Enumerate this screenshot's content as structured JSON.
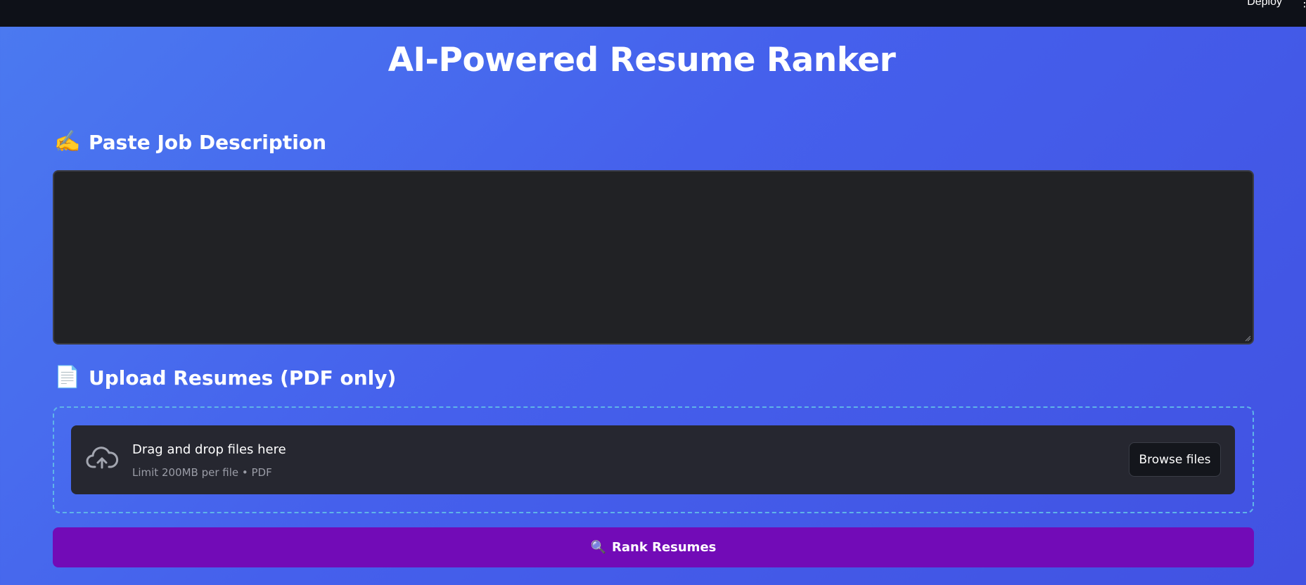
{
  "header": {
    "deploy_label": "Deploy",
    "menu_icon": "kebab-menu-icon"
  },
  "page": {
    "title": "AI-Powered Resume Ranker"
  },
  "job_description": {
    "heading": "Paste Job Description",
    "heading_icon": "✍️",
    "value": ""
  },
  "upload": {
    "heading": "Upload Resumes (PDF only)",
    "heading_icon": "📄",
    "drop_title": "Drag and drop files here",
    "drop_limit": "Limit 200MB per file • PDF",
    "browse_label": "Browse files",
    "cloud_icon": "cloud-upload-icon"
  },
  "actions": {
    "rank_icon": "🔍",
    "rank_label": "Rank Resumes"
  },
  "colors": {
    "topbar": "#0e1118",
    "background_start": "#4b7af0",
    "background_end": "#4152e2",
    "input_bg": "#212225",
    "dropzone_bg": "#262730",
    "dropzone_border": "#5fb3e8",
    "rank_button": "#720bb7"
  }
}
